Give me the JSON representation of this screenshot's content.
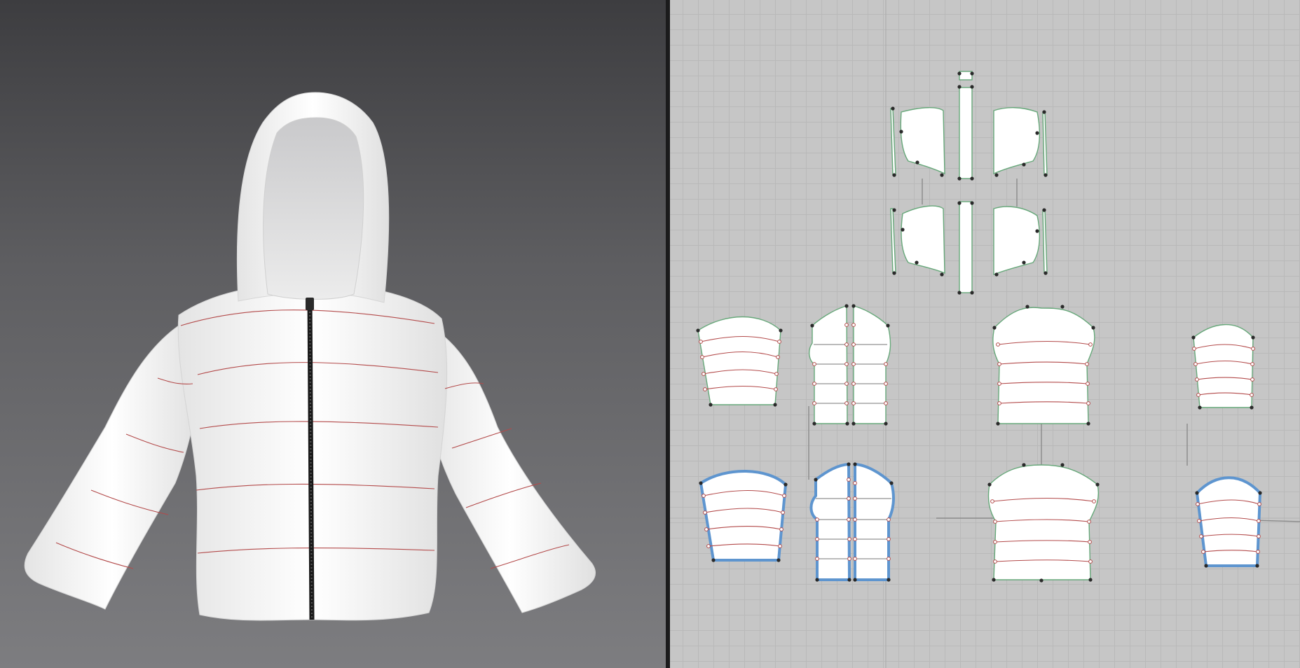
{
  "app": {
    "views": [
      "3d-garment-view",
      "2d-pattern-view"
    ]
  },
  "colors": {
    "background_3d_top": "#3d3d40",
    "background_3d_bottom": "#7d7d80",
    "background_2d": "#c6c6c6",
    "grid": "#b9b9b9",
    "fabric": "#ffffff",
    "topstitch": "#b34a4a",
    "pattern_outline": "#67a87a",
    "selected_outline": "#5e95cf",
    "zipper": "#1a1a1a"
  },
  "garment": {
    "type": "hooded puffer jacket",
    "icon": "jacket-icon",
    "zipper": "center-front-zipper"
  },
  "pattern": {
    "icon": "pattern-pieces-icon",
    "pieces": [
      "hood-side-left",
      "hood-center-strip",
      "hood-side-right",
      "hood-lining-left",
      "hood-lining-center",
      "hood-lining-right",
      "sleeve-left",
      "front-left",
      "front-right",
      "back",
      "sleeve-right",
      "sleeve-left-lining",
      "front-left-lining",
      "front-right-lining",
      "back-lining",
      "sleeve-right-lining"
    ]
  }
}
